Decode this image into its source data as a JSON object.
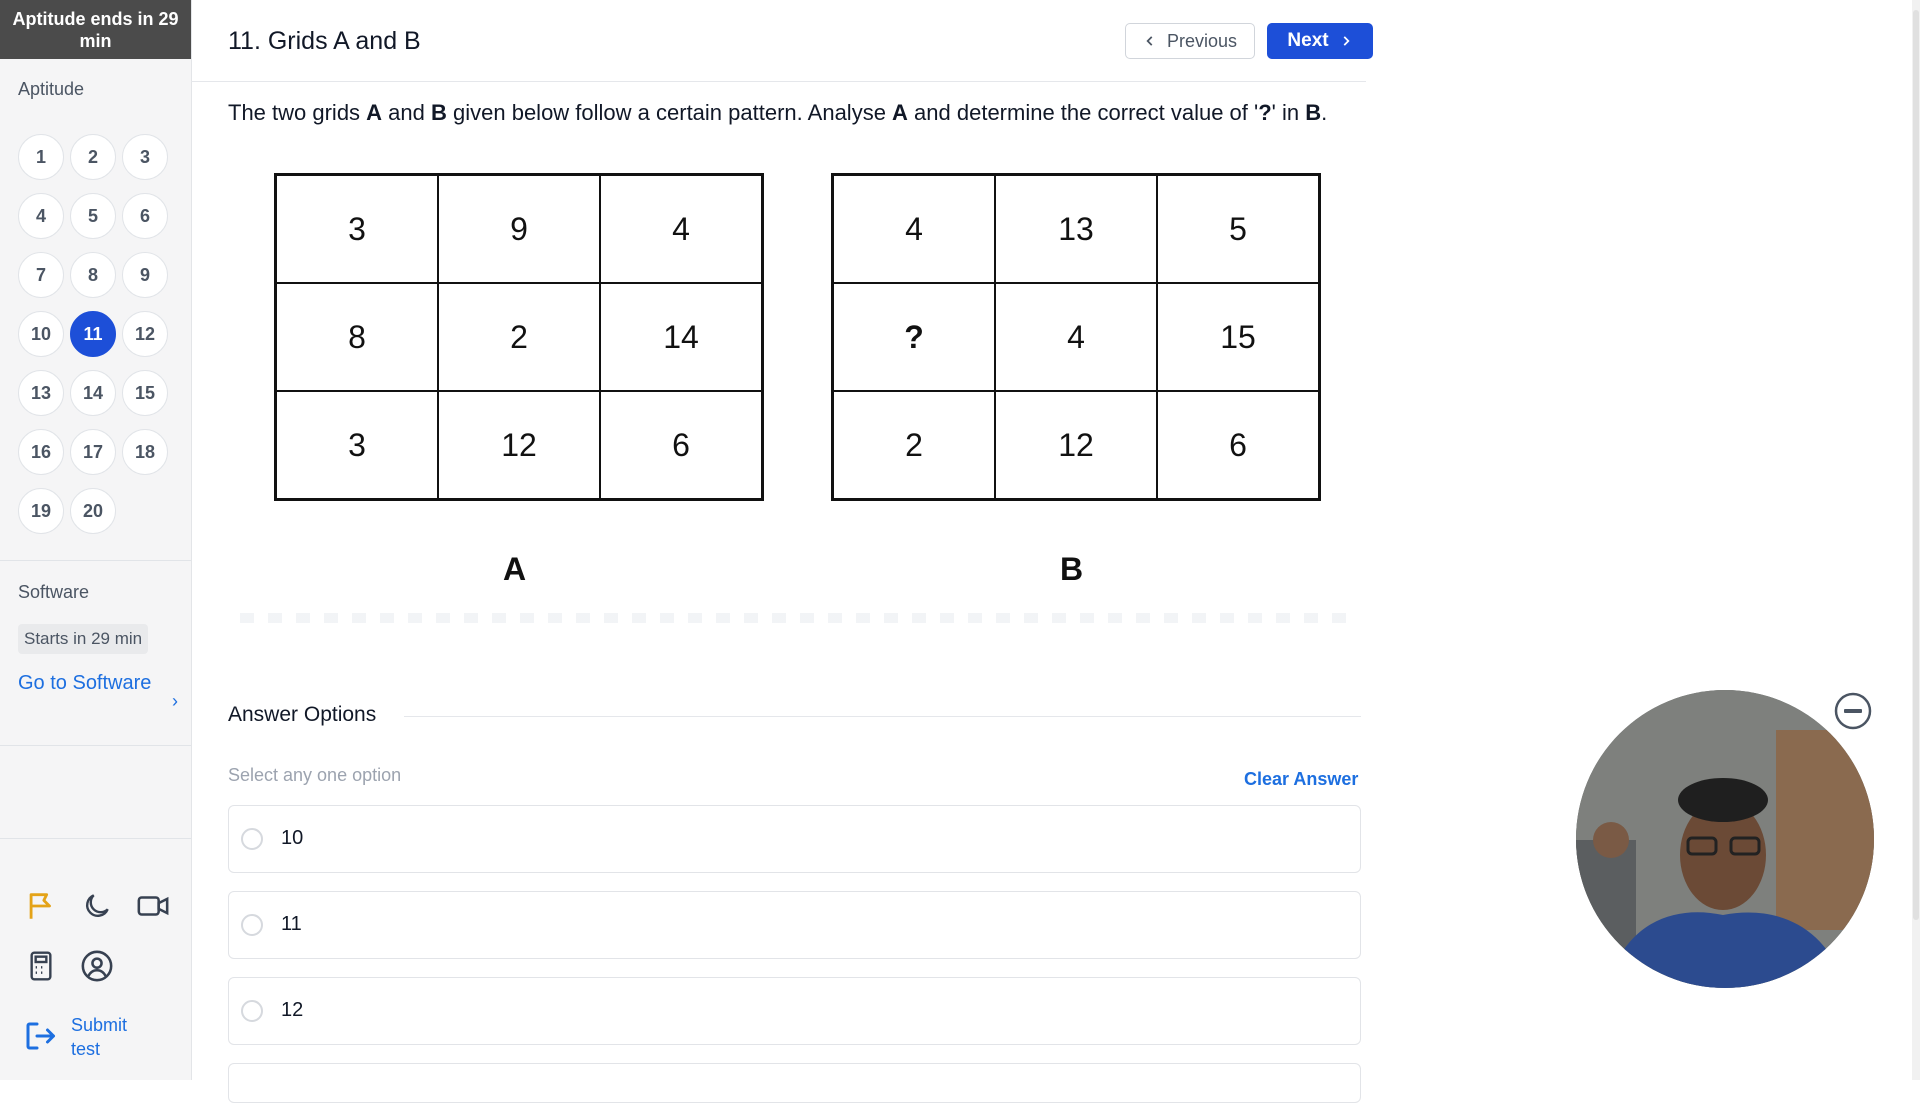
{
  "sidebar": {
    "timer": "Aptitude ends in 29 min",
    "section": "Aptitude",
    "questions": [
      "1",
      "2",
      "3",
      "4",
      "5",
      "6",
      "7",
      "8",
      "9",
      "10",
      "11",
      "12",
      "13",
      "14",
      "15",
      "16",
      "17",
      "18",
      "19",
      "20"
    ],
    "active_question": "11",
    "software_label": "Software",
    "software_status": "Starts in 29 min",
    "goto_label": "Go to Software",
    "goto_chevron": "›",
    "submit_label": "Submit test",
    "tool_icons": [
      "flag-icon",
      "moon-icon",
      "video-icon",
      "calculator-icon",
      "user-circle-icon",
      "logout-icon"
    ],
    "flag_color": "#e4a318"
  },
  "header": {
    "title": "11. Grids A and B",
    "prev_label": "Previous",
    "next_label": "Next",
    "accent": "#1d4fd8"
  },
  "question": {
    "text_parts": [
      "The two grids ",
      "A",
      " and ",
      "B",
      " given below follow a certain pattern. Analyse ",
      "A",
      " and determine the correct value of '",
      "?",
      "' in ",
      "B",
      "."
    ]
  },
  "grids": {
    "A": {
      "label": "A",
      "cells": [
        [
          "3",
          "9",
          "4"
        ],
        [
          "8",
          "2",
          "14"
        ],
        [
          "3",
          "12",
          "6"
        ]
      ]
    },
    "B": {
      "label": "B",
      "cells": [
        [
          "4",
          "13",
          "5"
        ],
        [
          "?",
          "4",
          "15"
        ],
        [
          "2",
          "12",
          "6"
        ]
      ]
    }
  },
  "answers": {
    "title": "Answer Options",
    "hint": "Select any one option",
    "clear_label": "Clear Answer",
    "options": [
      "10",
      "11",
      "12"
    ]
  }
}
